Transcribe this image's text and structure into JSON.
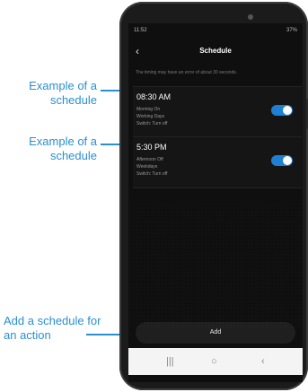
{
  "annotations": {
    "first_schedule": "Example of a schedule",
    "second_schedule": "Example of a schedule",
    "add_action": "Add a schedule for an action"
  },
  "status_bar": {
    "time": "11:52",
    "indicators": "37%"
  },
  "header": {
    "back_icon": "chevron-left-icon",
    "title": "Schedule"
  },
  "notice": "The timing may have an error of about 30 seconds.",
  "schedules": [
    {
      "time": "08:30 AM",
      "lines": [
        "Morning On",
        "Working Days",
        "Switch: Turn off"
      ],
      "enabled": true
    },
    {
      "time": "5:30 PM",
      "lines": [
        "Afternoon Off",
        "Weekdays",
        "Switch: Turn off"
      ],
      "enabled": true
    }
  ],
  "add_button": "Add",
  "nav_bar": {
    "recent": "|||",
    "home": "○",
    "back": "‹"
  },
  "colors": {
    "annotation": "#2a8fd1",
    "toggle_on": "#1e7fd3",
    "screen_bg": "#0f0f0f"
  }
}
